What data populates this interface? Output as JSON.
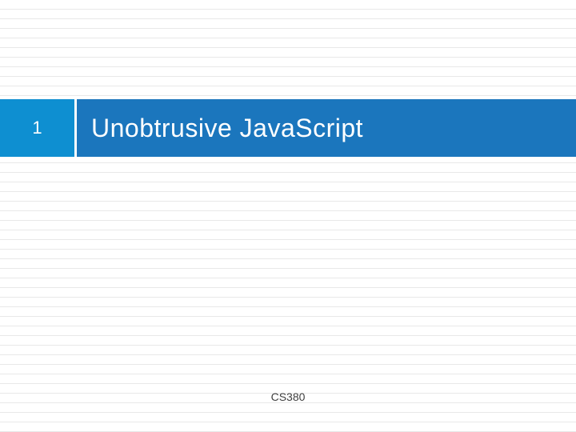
{
  "slide": {
    "page_number": "1",
    "title": "Unobtrusive JavaScript",
    "footer": "CS380"
  }
}
